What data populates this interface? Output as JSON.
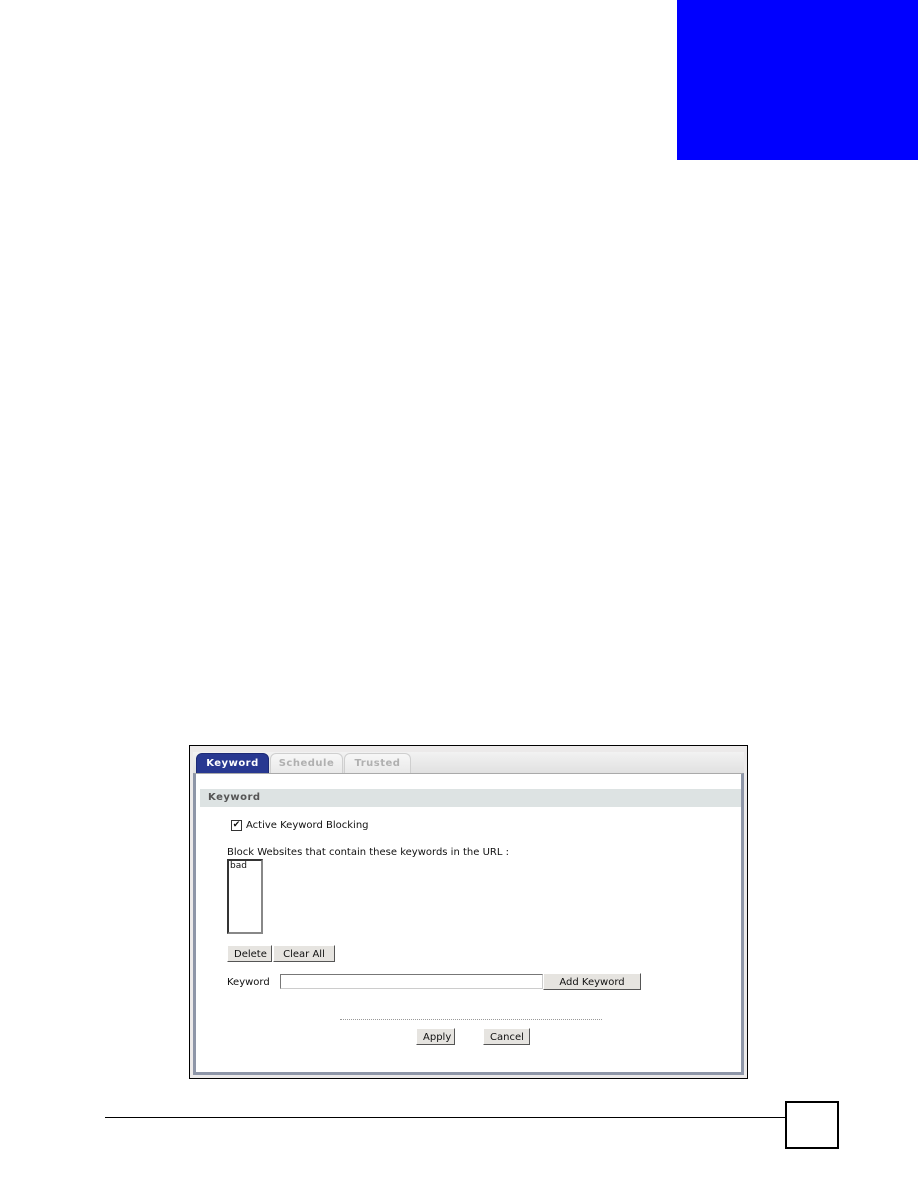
{
  "document": {
    "chapter_block_color": "#0000ff",
    "page_number": ""
  },
  "screenshot": {
    "tabs": [
      {
        "label": "Keyword",
        "active": true
      },
      {
        "label": "Schedule",
        "active": false
      },
      {
        "label": "Trusted",
        "active": false
      }
    ],
    "section_title": "Keyword",
    "active_blocking": {
      "label": "Active Keyword Blocking",
      "checked": true,
      "check_glyph": "✔"
    },
    "list_label": "Block Websites that contain these keywords in the URL :",
    "keywords": [
      "bad"
    ],
    "buttons": {
      "delete": "Delete",
      "clear_all": "Clear All",
      "add_keyword": "Add Keyword",
      "apply": "Apply",
      "cancel": "Cancel"
    },
    "keyword_field": {
      "label": "Keyword",
      "value": "",
      "placeholder": ""
    },
    "colors": {
      "active_tab": "#283891",
      "section_header": "#dde3e3"
    }
  }
}
